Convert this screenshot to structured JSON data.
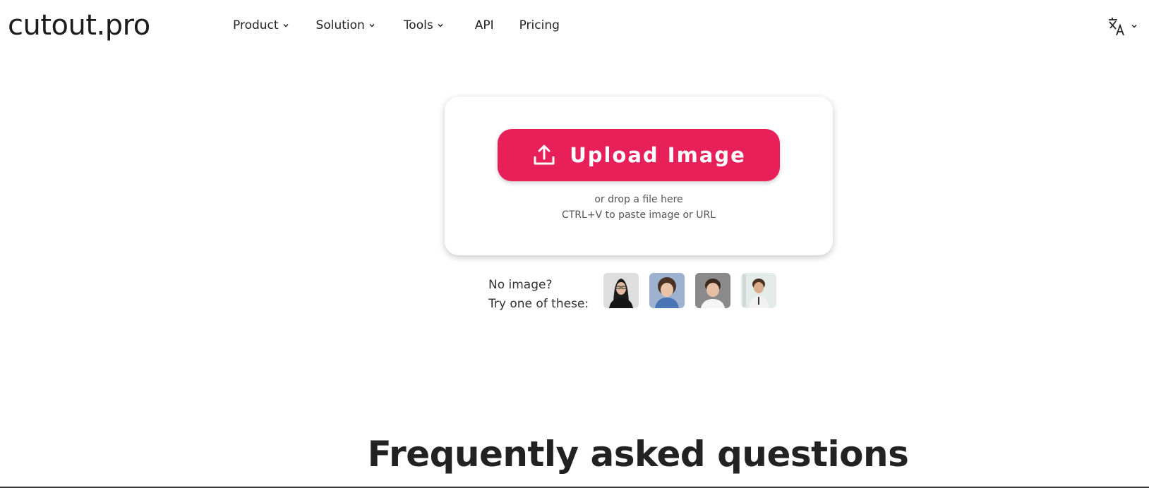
{
  "header": {
    "logo": "cutout.pro",
    "nav": [
      {
        "label": "Product",
        "has_dropdown": true
      },
      {
        "label": "Solution",
        "has_dropdown": true
      },
      {
        "label": "Tools",
        "has_dropdown": true
      },
      {
        "label": "API",
        "has_dropdown": false
      },
      {
        "label": "Pricing",
        "has_dropdown": false
      }
    ],
    "language_icon": "translate-icon"
  },
  "upload": {
    "button_label": "Upload Image",
    "button_icon": "upload-icon",
    "drop_hint": "or drop a file here",
    "paste_hint": "CTRL+V to paste image or URL",
    "accent_color": "#e8205a"
  },
  "samples": {
    "line1": "No image?",
    "line2": "Try one of these:",
    "thumbnails": [
      {
        "name": "woman-with-glasses"
      },
      {
        "name": "curly-haired-child"
      },
      {
        "name": "boy-white-shirt"
      },
      {
        "name": "boy-vest"
      }
    ]
  },
  "faq": {
    "title": "Frequently asked questions"
  }
}
